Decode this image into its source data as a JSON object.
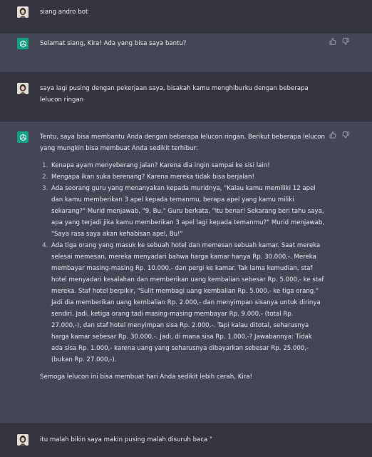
{
  "messages": [
    {
      "role": "user",
      "text": "siang andro bot"
    },
    {
      "role": "assistant",
      "text": "Selamat siang, Kira! Ada yang bisa saya bantu?"
    },
    {
      "role": "user",
      "text": "saya lagi pusing dengan pekerjaan saya, bisakah kamu menghiburku dengan beberapa lelucon ringan"
    },
    {
      "role": "assistant",
      "intro": "Tentu, saya bisa membantu Anda dengan beberapa lelucon ringan. Berikut beberapa lelucon yang mungkin bisa membuat Anda sedikit terhibur:",
      "jokes": [
        "Kenapa ayam menyeberang jalan? Karena dia ingin sampai ke sisi lain!",
        "Mengapa ikan suka berenang? Karena mereka tidak bisa berjalan!",
        "Ada seorang guru yang menanyakan kepada muridnya, \"Kalau kamu memiliki 12 apel dan kamu memberikan 3 apel kepada temanmu, berapa apel yang kamu miliki sekarang?\" Murid menjawab, \"9, Bu.\" Guru berkata, \"Itu benar! Sekarang beri tahu saya, apa yang terjadi jika kamu memberikan 3 apel lagi kepada temanmu?\" Murid menjawab, \"Saya rasa saya akan kehabisan apel, Bu!\"",
        "Ada tiga orang yang masuk ke sebuah hotel dan memesan sebuah kamar. Saat mereka selesai memesan, mereka menyadari bahwa harga kamar hanya Rp. 30.000,-. Mereka membayar masing-masing Rp. 10.000,- dan pergi ke kamar. Tak lama kemudian, staf hotel menyadari kesalahan dan memberikan uang kembalian sebesar Rp. 5.000,- ke staf mereka. Staf hotel berpikir, \"Sulit membagi uang kembalian Rp. 5.000,- ke tiga orang.\" Jadi dia memberikan uang kembalian Rp. 2.000,- dan menyimpan sisanya untuk dirinya sendiri. Jadi, ketiga orang tadi masing-masing membayar Rp. 9.000,- (total Rp. 27.000,-), dan staf hotel menyimpan sisa Rp. 2.000,-. Tapi kalau ditotal, seharusnya harga kamar sebesar Rp. 30.000,-. Jadi, di mana sisa Rp. 1.000,-? Jawabannya: Tidak ada sisa Rp. 1.000,- karena uang yang seharusnya dibayarkan sebesar Rp. 25.000,- (bukan Rp. 27.000,-)."
      ],
      "outro": "Semoga lelucon ini bisa membuat hari Anda sedikit lebih cerah, Kira!"
    },
    {
      "role": "user",
      "text": "itu malah bikin saya makin pusing malah disuruh baca \""
    }
  ],
  "icons": {
    "user_avatar": "user-avatar-photo",
    "bot_avatar": "openai-logo-icon",
    "like": "thumbs-up-icon",
    "dislike": "thumbs-down-icon"
  },
  "colors": {
    "user_bg": "#343541",
    "bot_bg": "#444654",
    "bot_avatar": "#10a37f",
    "text": "#ececf1",
    "icon": "#acacbe"
  }
}
